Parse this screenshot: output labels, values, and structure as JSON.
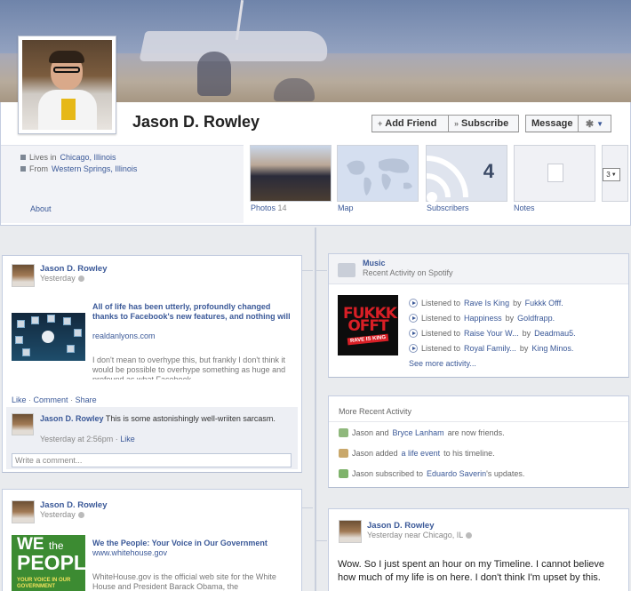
{
  "profile": {
    "name": "Jason D. Rowley",
    "buttons": {
      "add_friend": "Add Friend",
      "subscribe": "Subscribe",
      "message": "Message"
    },
    "about": {
      "lives_prefix": "Lives in",
      "lives_city": "Chicago, Illinois",
      "from_prefix": "From",
      "from_city": "Western Springs, Illinois",
      "link": "About"
    },
    "tiles": {
      "photos_label": "Photos",
      "photos_count": "14",
      "map_label": "Map",
      "subscribers_label": "Subscribers",
      "subscribers_count": "4",
      "notes_label": "Notes",
      "more_count": "3"
    }
  },
  "post1": {
    "author": "Jason D. Rowley",
    "time": "Yesterday",
    "share_title": "All of life has been utterly, profoundly changed thanks to Facebook's new features, and nothing will",
    "share_url": "realdanlyons.com",
    "share_desc": "I don't mean to overhype this, but frankly I don't think it would be possible to overhype something as huge and profound as what Facebook",
    "actions": {
      "like": "Like",
      "comment": "Comment",
      "share": "Share"
    },
    "comment": {
      "author": "Jason D. Rowley",
      "text": "This is some astonishingly well-wriiten sarcasm.",
      "time": "Yesterday at 2:56pm",
      "like": "Like"
    },
    "comment_placeholder": "Write a comment..."
  },
  "post2": {
    "author": "Jason D. Rowley",
    "time": "Yesterday",
    "share_title": "We the People: Your Voice in Our Government",
    "share_url": "www.whitehouse.gov",
    "share_desc": "WhiteHouse.gov is the official web site for the White House and President Barack Obama, the",
    "image_text": {
      "w1": "WE",
      "w1b": "the",
      "w2": "PEOPLE",
      "w3": "YOUR VOICE IN OUR GOVERNMENT"
    }
  },
  "music": {
    "title": "Music",
    "subtitle": "Recent Activity on Spotify",
    "album_art_text": {
      "big": "FUKKK OFFT",
      "small": "RAVE IS KING"
    },
    "items": [
      {
        "prefix": "Listened to",
        "track": "Rave Is King",
        "by": "by",
        "artist": "Fukkk Offf."
      },
      {
        "prefix": "Listened to",
        "track": "Happiness",
        "by": "by",
        "artist": "Goldfrapp."
      },
      {
        "prefix": "Listened to",
        "track": "Raise Your W...",
        "by": "by",
        "artist": "Deadmau5."
      },
      {
        "prefix": "Listened to",
        "track": "Royal Family...",
        "by": "by",
        "artist": "King Minos."
      }
    ],
    "see_more": "See more activity..."
  },
  "recent": {
    "title": "More Recent Activity",
    "items": [
      {
        "a": "Jason and",
        "link": "Bryce Lanham",
        "b": "are now friends."
      },
      {
        "a": "Jason added",
        "link": "a life event",
        "b": "to his timeline."
      },
      {
        "a": "Jason subscribed to",
        "link": "Eduardo Saverin",
        "b": "'s updates."
      }
    ]
  },
  "post3": {
    "author": "Jason D. Rowley",
    "time": "Yesterday near Chicago, IL",
    "text": "Wow. So I just spent an hour on my Timeline. I cannot believe how much of my life is on here. I don't think I'm upset by this."
  },
  "colors": {
    "link": "#3b5998",
    "background": "#e9ebee",
    "spotify_red": "#d91f26",
    "whitehouse_green": "#3c8b32"
  }
}
